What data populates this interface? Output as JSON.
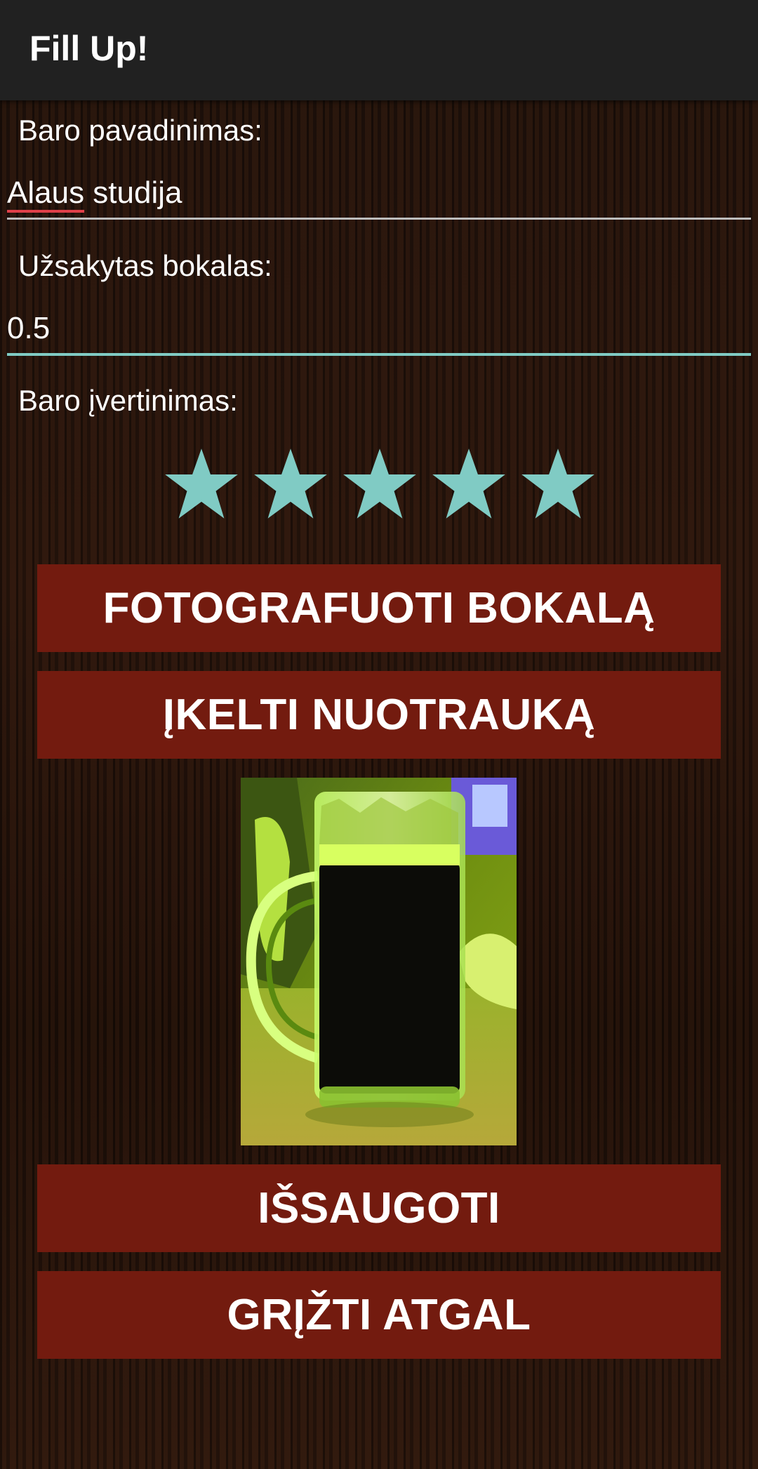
{
  "appbar": {
    "title": "Fill Up!"
  },
  "bar_name": {
    "label": "Baro pavadinimas:",
    "value_word1": "Alaus",
    "value_rest": " studija"
  },
  "mug": {
    "label": "Užsakytas bokalas:",
    "value": "0.5"
  },
  "rating": {
    "label": "Baro įvertinimas:",
    "value": 5,
    "max": 5
  },
  "buttons": {
    "take_photo": "FOTOGRAFUOTI BOKALĄ",
    "upload_photo": "ĮKELTI NUOTRAUKĄ",
    "save": "IŠSAUGOTI",
    "back": "GRĮŽTI ATGAL"
  },
  "colors": {
    "accent": "#80cbc4",
    "button": "#731b0f",
    "appbar": "#212121",
    "spellcheck": "#e0404a",
    "field_line_inactive": "#bdbdbd"
  }
}
